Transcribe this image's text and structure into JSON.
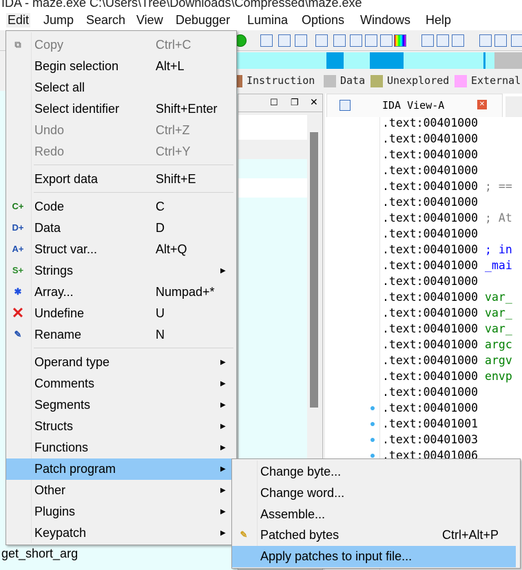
{
  "window": {
    "title": "IDA - maze.exe C:\\Users\\Tree\\Downloads\\Compressed\\maze.exe"
  },
  "menubar": [
    "Edit",
    "Jump",
    "Search",
    "View",
    "Debugger",
    "Lumina",
    "Options",
    "Windows",
    "Help"
  ],
  "legend": [
    {
      "label": "Instruction",
      "color": "#b0704a"
    },
    {
      "label": "Data",
      "color": "#c0c0c0"
    },
    {
      "label": "Unexplored",
      "color": "#b4b46c"
    },
    {
      "label": "External",
      "color": "#ffa8ff"
    }
  ],
  "nav_colors": {
    "code": "#a8fbfb",
    "function": "#00a0e6",
    "data": "#c0c0c0"
  },
  "edit_menu": [
    {
      "label": "Copy",
      "shortcut": "Ctrl+C",
      "disabled": true,
      "icon": "copy-icon"
    },
    {
      "label": "Begin selection",
      "shortcut": "Alt+L"
    },
    {
      "label": "Select all",
      "shortcut": ""
    },
    {
      "label": "Select identifier",
      "shortcut": "Shift+Enter"
    },
    {
      "label": "Undo",
      "shortcut": "Ctrl+Z",
      "disabled": true
    },
    {
      "label": "Redo",
      "shortcut": "Ctrl+Y",
      "disabled": true
    },
    {
      "label": "Export data",
      "shortcut": "Shift+E"
    },
    {
      "label": "Code",
      "shortcut": "C",
      "icon": "code-icon"
    },
    {
      "label": "Data",
      "shortcut": "D",
      "icon": "data-icon"
    },
    {
      "label": "Struct var...",
      "shortcut": "Alt+Q",
      "icon": "struct-var-icon"
    },
    {
      "label": "Strings",
      "shortcut": "",
      "submenu": true,
      "icon": "strings-icon"
    },
    {
      "label": "Array...",
      "shortcut": "Numpad+*",
      "icon": "array-icon"
    },
    {
      "label": "Undefine",
      "shortcut": "U",
      "icon": "undefine-icon"
    },
    {
      "label": "Rename",
      "shortcut": "N",
      "icon": "rename-icon"
    },
    {
      "label": "Operand type",
      "submenu": true
    },
    {
      "label": "Comments",
      "submenu": true
    },
    {
      "label": "Segments",
      "submenu": true
    },
    {
      "label": "Structs",
      "submenu": true
    },
    {
      "label": "Functions",
      "submenu": true
    },
    {
      "label": "Patch program",
      "submenu": true,
      "highlighted": true
    },
    {
      "label": "Other",
      "submenu": true
    },
    {
      "label": "Plugins",
      "submenu": true
    },
    {
      "label": "Keypatch",
      "submenu": true
    }
  ],
  "patch_submenu": [
    {
      "label": "Change byte...",
      "shortcut": ""
    },
    {
      "label": "Change word...",
      "shortcut": ""
    },
    {
      "label": "Assemble...",
      "shortcut": ""
    },
    {
      "label": "Patched bytes",
      "shortcut": "Ctrl+Alt+P",
      "icon": "patched-bytes-icon"
    },
    {
      "label": "Apply patches to input file...",
      "shortcut": "",
      "highlighted": true
    }
  ],
  "ida_view": {
    "tab_label": "IDA View-A",
    "lines": [
      {
        "addr": ".text:00401000",
        "rest": "",
        "color": "#000"
      },
      {
        "addr": ".text:00401000",
        "rest": "",
        "color": "#000"
      },
      {
        "addr": ".text:00401000",
        "rest": "",
        "color": "#000"
      },
      {
        "addr": ".text:00401000",
        "rest": "",
        "color": "#000"
      },
      {
        "addr": ".text:00401000",
        "rest": " ; ==",
        "color": "#808080"
      },
      {
        "addr": ".text:00401000",
        "rest": "",
        "color": "#000"
      },
      {
        "addr": ".text:00401000",
        "rest": " ; At",
        "color": "#808080"
      },
      {
        "addr": ".text:00401000",
        "rest": "",
        "color": "#000"
      },
      {
        "addr": ".text:00401000",
        "rest": " ; in",
        "color": "#0000ff"
      },
      {
        "addr": ".text:00401000",
        "rest": " _mai",
        "color": "#0000ff"
      },
      {
        "addr": ".text:00401000",
        "rest": "",
        "color": "#000"
      },
      {
        "addr": ".text:00401000",
        "rest": " var_",
        "color": "#008000"
      },
      {
        "addr": ".text:00401000",
        "rest": " var_",
        "color": "#008000"
      },
      {
        "addr": ".text:00401000",
        "rest": " var_",
        "color": "#008000"
      },
      {
        "addr": ".text:00401000",
        "rest": " argc",
        "color": "#008000"
      },
      {
        "addr": ".text:00401000",
        "rest": " argv",
        "color": "#008000"
      },
      {
        "addr": ".text:00401000",
        "rest": " envp",
        "color": "#008000"
      },
      {
        "addr": ".text:00401000",
        "rest": "",
        "color": "#000"
      },
      {
        "addr": ".text:00401000",
        "rest": "",
        "color": "#000"
      },
      {
        "addr": ".text:00401001",
        "rest": "",
        "color": "#000"
      },
      {
        "addr": ".text:00401003",
        "rest": "",
        "color": "#000"
      },
      {
        "addr": ".text:00401006",
        "rest": "",
        "color": "#000"
      }
    ]
  },
  "left_panel": {
    "visible_item": "get_short_arg"
  }
}
